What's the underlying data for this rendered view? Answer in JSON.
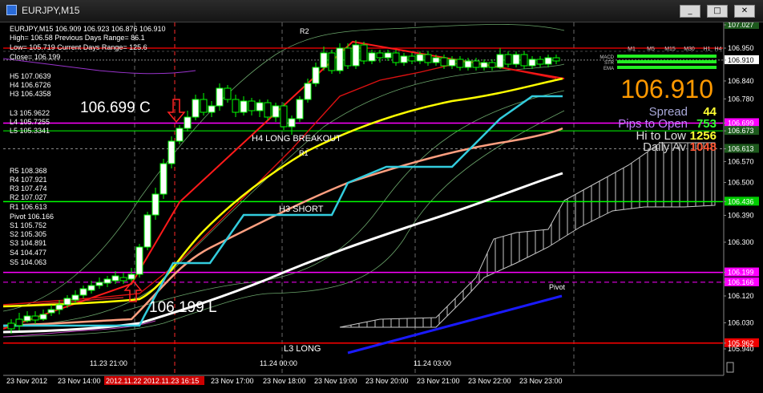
{
  "window": {
    "title": "EURJPY,M15",
    "min_label": "_",
    "max_label": "□",
    "close_label": "✕"
  },
  "header": {
    "line1": "EURJPY,M15  106.909 106.923 106.876 106.910",
    "line2": "High= 106.58    Previous Days Range= 86.1",
    "line3": "Low= 105.719    Current Days Range= 125.6",
    "line4": "Close= 106.199"
  },
  "levels_left": [
    "H5 107.0639",
    "H4 106.6726",
    "H3 106.4358",
    "",
    "L3 105.9622",
    "L4 105.7255",
    "L5 105.3341",
    "",
    "R5 108.368",
    "R4 107.921",
    "R3 107.474",
    "R2 107.027",
    "R1 106.613",
    "Pivot 106.166",
    "S1 105.752",
    "S2 105.305",
    "S3 104.891",
    "S4 104.477",
    "S5 104.063"
  ],
  "annotations": {
    "big_c": "106.699  C",
    "big_l": "106.199  L",
    "h4_long": "H4 LONG BREAKOUT",
    "h3_short": "H3 SHORT",
    "l3_long": "L3 LONG",
    "r1": "R1",
    "r2": "R2",
    "pivot": "Pivot"
  },
  "panel": {
    "tf_labels": [
      "M1",
      "M5",
      "M15",
      "M30",
      "H1",
      "H4"
    ],
    "row_labels": [
      "MACD",
      "STR",
      "EMA"
    ],
    "big_price": "106.910",
    "spread_label": "Spread",
    "spread_value": "44",
    "pips_label": "Pips to Open",
    "pips_value": "753",
    "hilo_label": "Hi to Low",
    "hilo_value": "1256",
    "dav_label": "Daily Av",
    "dav_value": "1048"
  },
  "price_axis": {
    "ticks": [
      "107.027",
      "106.950",
      "106.910",
      "106.840",
      "106.780",
      "106.699",
      "106.673",
      "106.613",
      "106.570",
      "106.500",
      "106.436",
      "106.390",
      "106.300",
      "106.199",
      "106.166",
      "106.120",
      "106.030",
      "105.962",
      "105.940"
    ],
    "highlighted": [
      "107.027",
      "106.910",
      "106.699",
      "106.673",
      "106.613",
      "106.436",
      "106.199",
      "106.166",
      "105.962"
    ]
  },
  "time_axis": {
    "labels": [
      "23 Nov 2012",
      "23 Nov 14:00",
      "2012.11.22  2012.11.23 16:15",
      "23 Nov 17:00",
      "23 Nov 18:00",
      "23 Nov 19:00",
      "23 Nov 20:00",
      "23 Nov 21:00",
      "23 Nov 22:00",
      "23 Nov 23:00"
    ],
    "session_labels": [
      "11.23 21:00",
      "11.24 00:00",
      "11.24 03:00"
    ]
  },
  "colors": {
    "background": "#000000",
    "up_candle": "#ffffff",
    "down_candle": "#000000",
    "candle_wick": "#00ff00",
    "ema_yellow": "#ffff00",
    "ema_cyan": "#33ccdd",
    "ema_salmon": "#ff9f80",
    "ema_white": "#ffffff",
    "red_trend": "#ff1a1a",
    "pivot_line": "#1a1aff",
    "magenta_level": "#ff00ff",
    "green_level": "#00ff00",
    "red_level": "#ff0000",
    "ichimoku_cloud": "#c8c8c8",
    "panel_orange": "#ff9900"
  }
}
